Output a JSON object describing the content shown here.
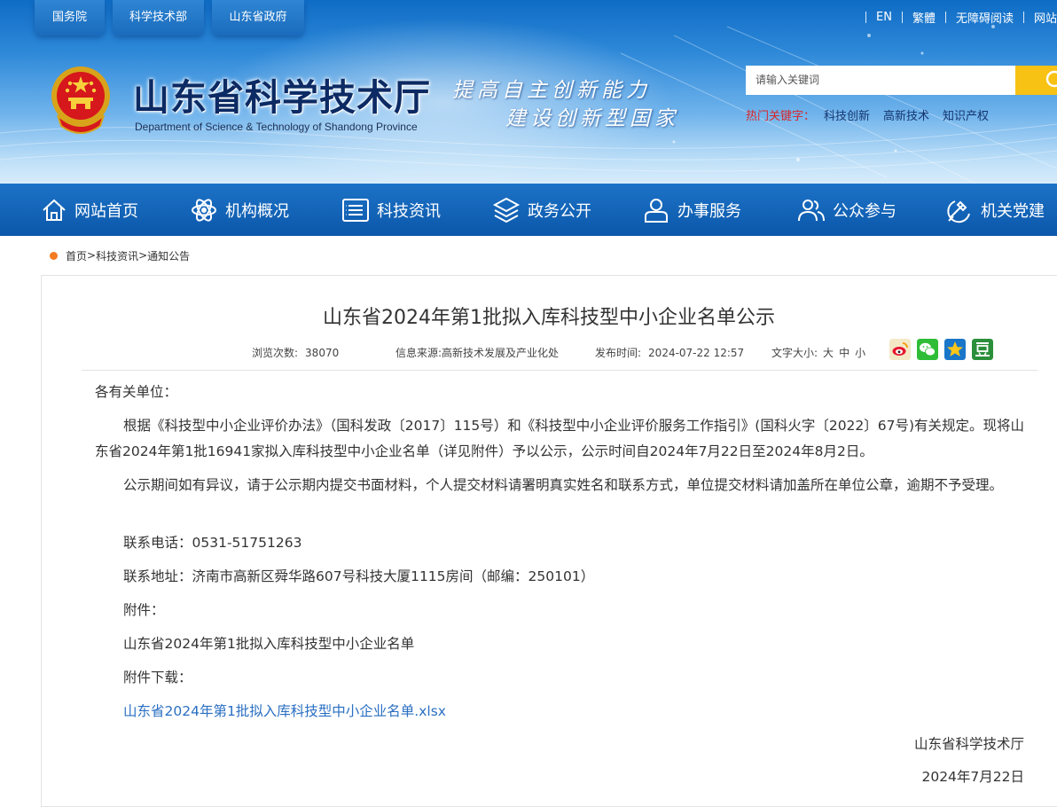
{
  "top_links": [
    "国务院",
    "科学技术部",
    "山东省政府"
  ],
  "util_links": [
    "EN",
    "繁體",
    "无障碍阅读",
    "网站"
  ],
  "site": {
    "title": "山东省科学技术厅",
    "subtitle": "Department of Science & Technology of Shandong Province",
    "slogan_line1": "提高自主创新能力",
    "slogan_line2": "建设创新型国家"
  },
  "search": {
    "placeholder": "请输入关键词",
    "hot_label": "热门关键字：",
    "hot_keywords": [
      "科技创新",
      "高新技术",
      "知识产权"
    ]
  },
  "nav": [
    {
      "label": "网站首页",
      "icon": "home-icon"
    },
    {
      "label": "机构概况",
      "icon": "atom-icon"
    },
    {
      "label": "科技资讯",
      "icon": "news-list-icon"
    },
    {
      "label": "政务公开",
      "icon": "layers-icon"
    },
    {
      "label": "办事服务",
      "icon": "user-service-icon"
    },
    {
      "label": "公众参与",
      "icon": "people-icon"
    },
    {
      "label": "机关党建",
      "icon": "party-emblem-icon"
    }
  ],
  "breadcrumb": [
    "首页",
    ">",
    "科技资讯",
    ">",
    "通知公告"
  ],
  "article": {
    "title": "山东省2024年第1批拟入库科技型中小企业名单公示",
    "meta": {
      "views_label": "浏览次数:",
      "views": "38070",
      "source_label": "信息来源:",
      "source": "高新技术发展及产业化处",
      "date_label": "发布时间:",
      "date": "2024-07-22 12:57",
      "fontsize_label": "文字大小:",
      "fontsizes": [
        "大",
        "中",
        "小"
      ]
    },
    "share_icons": [
      "weibo-icon",
      "wechat-icon",
      "qzone-icon",
      "douban-icon"
    ],
    "salutation": "各有关单位：",
    "para1": "根据《科技型中小企业评价办法》（国科发政〔2017〕115号）和《科技型中小企业评价服务工作指引》(国科火字〔2022〕67号)有关规定。现将山东省2024年第1批16941家拟入库科技型中小企业名单（详见附件）予以公示，公示时间自2024年7月22日至2024年8月2日。",
    "para2": "公示期间如有异议，请于公示期内提交书面材料，个人提交材料请署明真实姓名和联系方式，单位提交材料请加盖所在单位公章，逾期不予受理。",
    "phone": "联系电话：0531-51751263",
    "address": "联系地址：济南市高新区舜华路607号科技大厦1115房间（邮编：250101）",
    "attachment_label": "附件：",
    "attachment_name": "山东省2024年第1批拟入库科技型中小企业名单",
    "download_label": "附件下载：",
    "download_file": "山东省2024年第1批拟入库科技型中小企业名单.xlsx",
    "sign_org": "山东省科学技术厅",
    "sign_date": "2024年7月22日"
  },
  "colors": {
    "nav_blue": "#0b57aa",
    "search_button": "#f7c214",
    "hot_label": "#d7262a",
    "link": "#2a6fc2",
    "breadcrumb_dot": "#f47a20"
  }
}
